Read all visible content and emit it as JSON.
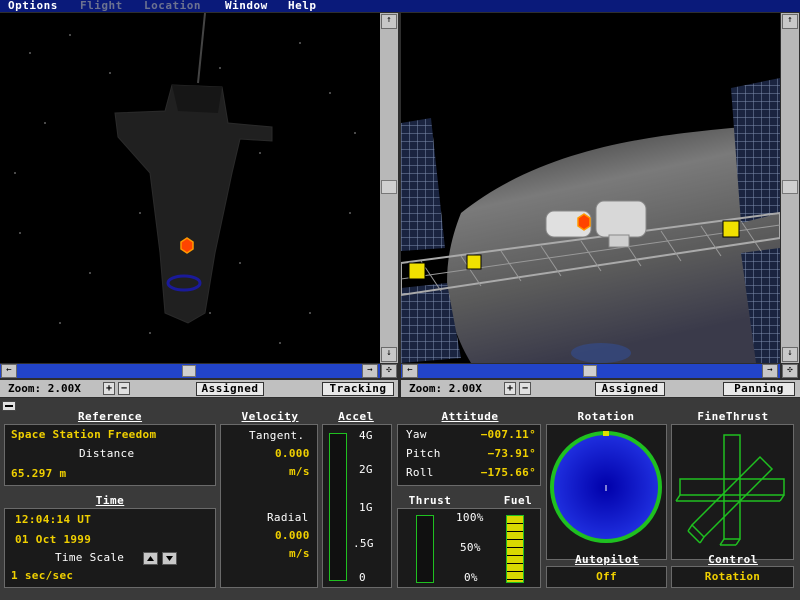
{
  "menu": [
    "Options",
    "Flight",
    "Location",
    "Window",
    "Help"
  ],
  "left_view": {
    "zoom_label": "Zoom: 2.00X",
    "zoom_in": "+",
    "zoom_out": "−",
    "assigned_button": "Assigned",
    "mode_button": "Tracking"
  },
  "right_view": {
    "zoom_label": "Zoom: 2.00X",
    "zoom_in": "+",
    "zoom_out": "−",
    "assigned_button": "Assigned",
    "mode_button": "Panning"
  },
  "scroll": {
    "up": "↑",
    "down": "↓",
    "left": "←",
    "right": "→",
    "corner": "✣"
  },
  "reference": {
    "header": "Reference",
    "target": "Space Station Freedom",
    "distance_label": "Distance",
    "distance_value": "65.297 m"
  },
  "time": {
    "header": "Time",
    "clock": "12:04:14 UT",
    "date": "01 Oct 1999",
    "time_scale_label": "Time Scale",
    "time_scale_value": "1 sec/sec"
  },
  "velocity": {
    "header": "Velocity",
    "tangent_label": "Tangent.",
    "tangent_value": "0.000",
    "tangent_unit": "m/s",
    "radial_label": "Radial",
    "radial_value": "0.000",
    "radial_unit": "m/s"
  },
  "accel": {
    "header": "Accel",
    "ticks": [
      "4G",
      "2G",
      "1G",
      ".5G",
      "0"
    ]
  },
  "attitude": {
    "header": "Attitude",
    "yaw_label": "Yaw",
    "yaw_value": "−007.11°",
    "pitch_label": "Pitch",
    "pitch_value": "−73.91°",
    "roll_label": "Roll",
    "roll_value": "−175.66°"
  },
  "thrust": {
    "header": "Thrust"
  },
  "fuel": {
    "header": "Fuel",
    "ticks": [
      "100%",
      "50%",
      "0%"
    ],
    "level": 1.0
  },
  "rotation": {
    "header": "Rotation"
  },
  "finethrust": {
    "header": "FineThrust"
  },
  "autopilot": {
    "header": "Autopilot",
    "value": "Off"
  },
  "control": {
    "header": "Control",
    "value": "Rotation"
  },
  "colors": {
    "menubar": "#0a1a7a",
    "accent_yellow": "#f0d000",
    "gauge_green": "#1fc020",
    "rotation_blue": "#1a1acc"
  }
}
